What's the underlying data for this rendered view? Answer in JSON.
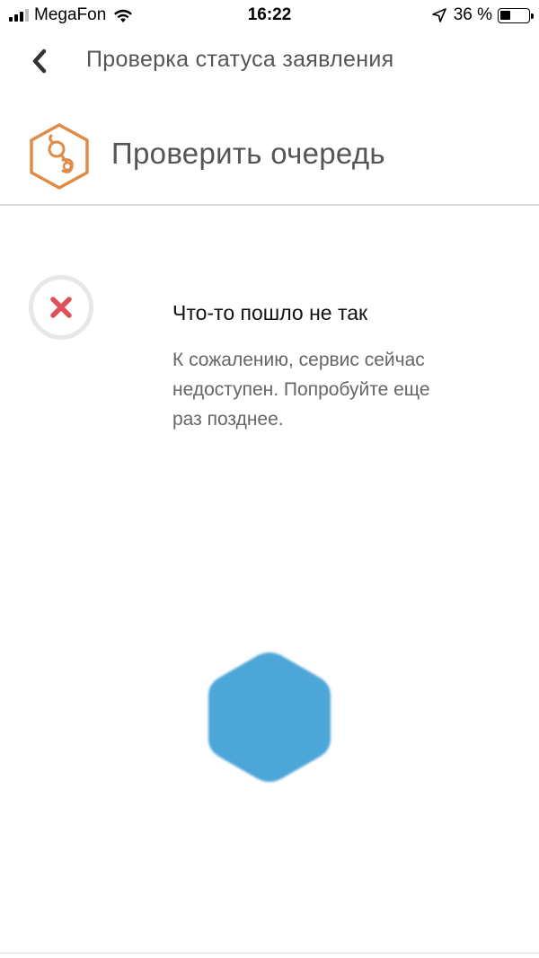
{
  "status_bar": {
    "carrier": "MegaFon",
    "time": "16:22",
    "battery_percent": "36 %",
    "battery_level": 0.36
  },
  "nav": {
    "title": "Проверка статуса заявления"
  },
  "service": {
    "title": "Проверить очередь",
    "icon": "pacifier-icon",
    "accent_color": "#e08a45"
  },
  "error": {
    "title": "Что-то пошло не так",
    "message": "К сожалению, сервис сейчас недоступен. Попробуйте еще раз позднее.",
    "icon": "close-icon",
    "icon_color": "#e0505a"
  },
  "loader": {
    "icon": "hexagon-loader-icon",
    "color": "#4da6d8"
  }
}
